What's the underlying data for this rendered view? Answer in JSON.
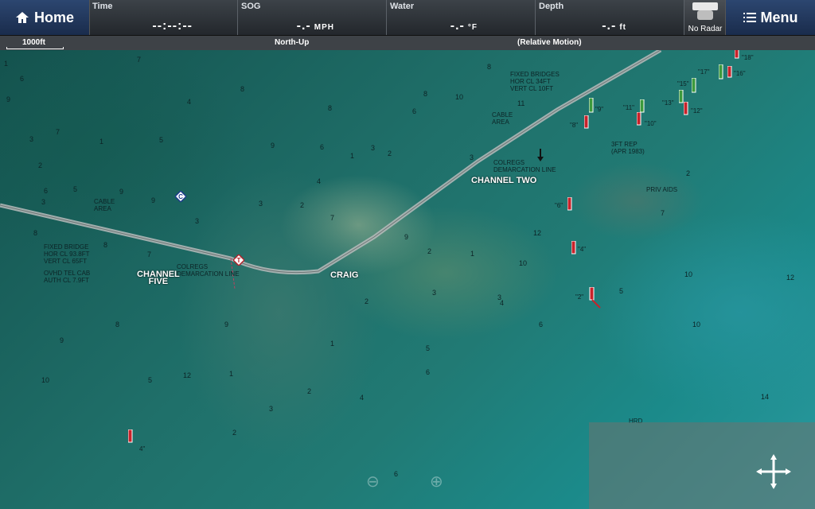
{
  "topbar": {
    "home_label": "Home",
    "menu_label": "Menu",
    "time": {
      "label": "Time",
      "value": "--:--:--"
    },
    "sog": {
      "label": "SOG",
      "value": "-.-",
      "unit": "MPH"
    },
    "water": {
      "label": "Water",
      "value": "-.-",
      "unit": "°F"
    },
    "depth": {
      "label": "Depth",
      "value": "-.-",
      "unit": "ft"
    },
    "radar": {
      "label": "No Radar"
    }
  },
  "status": {
    "scale": "1000ft",
    "orientation": "North-Up",
    "motion": "(Relative Motion)"
  },
  "map": {
    "labels": [
      {
        "id": "fixed-bridges",
        "text": "FIXED BRIDGES\nHOR CL 34FT\nVERT CL 10FT"
      },
      {
        "id": "cable-area-ne",
        "text": "CABLE\nAREA"
      },
      {
        "id": "colregs-ne",
        "text": "COLREGS\nDEMARCATION LINE"
      },
      {
        "id": "channel-two",
        "text": "CHANNEL TWO"
      },
      {
        "id": "priv-aids",
        "text": "PRIV AIDS"
      },
      {
        "id": "rep",
        "text": "3FT REP\n(APR 1983)"
      },
      {
        "id": "cable-area-w",
        "text": "CABLE\nAREA"
      },
      {
        "id": "fixed-bridge-w",
        "text": "FIXED BRIDGE\nHOR CL 93.8FT\nVERT CL 65FT"
      },
      {
        "id": "ovhd",
        "text": "OVHD TEL CAB\nAUTH CL 7.9FT"
      },
      {
        "id": "colregs-w",
        "text": "COLREGS\nDEMARCATION LINE"
      },
      {
        "id": "channel-five",
        "text": "CHANNEL\nFIVE"
      },
      {
        "id": "craig",
        "text": "CRAIG"
      },
      {
        "id": "hrd",
        "text": "HRD"
      }
    ],
    "buoys": [
      {
        "id": "b17",
        "text": "\"17\""
      },
      {
        "id": "b18",
        "text": "\"18\""
      },
      {
        "id": "b16",
        "text": "\"16\""
      },
      {
        "id": "b15",
        "text": "\"15\""
      },
      {
        "id": "b13",
        "text": "\"13\""
      },
      {
        "id": "b12",
        "text": "\"12\""
      },
      {
        "id": "b11",
        "text": "\"11\""
      },
      {
        "id": "b10",
        "text": "\"10\""
      },
      {
        "id": "b9",
        "text": "\"9\""
      },
      {
        "id": "b8",
        "text": "\"8\""
      },
      {
        "id": "b6",
        "text": "\"6\""
      },
      {
        "id": "b4",
        "text": "\"4\""
      },
      {
        "id": "b2",
        "text": "\"2\""
      },
      {
        "id": "b4w",
        "text": "4\""
      }
    ],
    "depths": [
      "1",
      "6",
      "7",
      "9",
      "3",
      "7",
      "2",
      "6",
      "3",
      "5",
      "9",
      "8",
      "9",
      "8",
      "1",
      "4",
      "3",
      "7",
      "5",
      "8",
      "3",
      "9",
      "2",
      "1",
      "4",
      "6",
      "8",
      "2",
      "3",
      "2",
      "7",
      "9",
      "10",
      "8",
      "8",
      "6",
      "11",
      "12",
      "1",
      "3",
      "3",
      "10",
      "2",
      "5",
      "4",
      "6",
      "12",
      "10",
      "2",
      "7",
      "14",
      "12",
      "8",
      "9",
      "3",
      "5",
      "2",
      "6",
      "1",
      "2",
      "9",
      "4",
      "6",
      "10",
      "10",
      "3",
      "1",
      "5"
    ]
  },
  "colors": {
    "topbar": "#2b3035",
    "button": "#1f3659",
    "water": "#1f6f69",
    "red": "#c8222a",
    "green": "#3c9a3c"
  }
}
